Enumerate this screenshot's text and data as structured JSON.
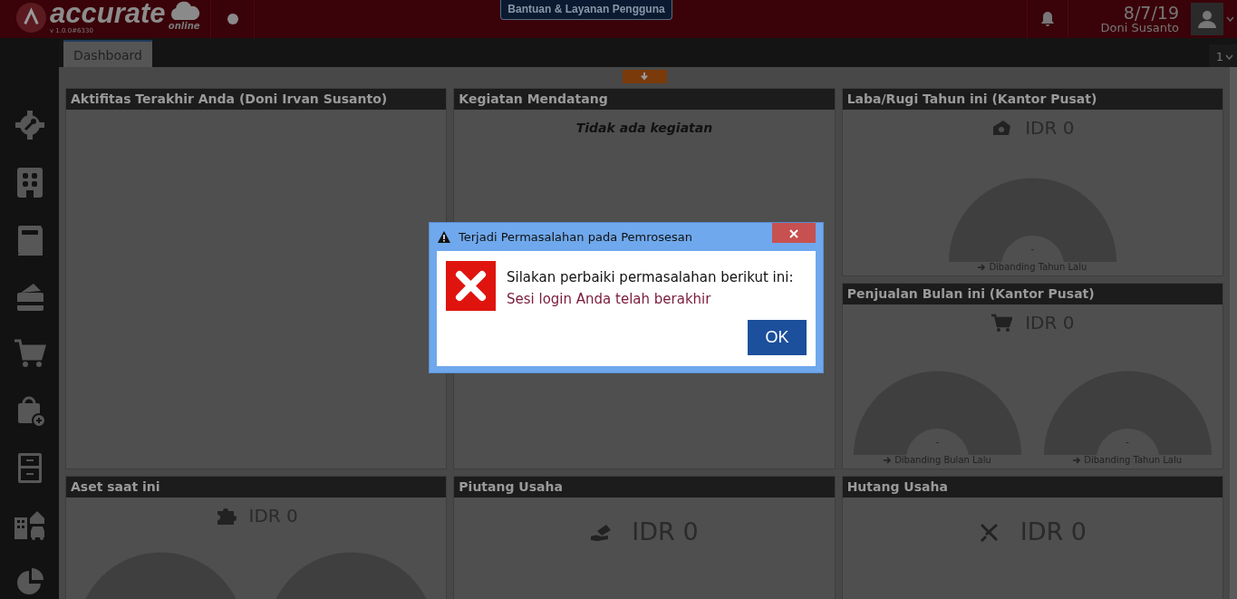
{
  "header": {
    "logo_text": "accurate",
    "logo_subtext": "online",
    "version": "v 1.0.0#6330",
    "help_button": "Bantuan & Layanan Pengguna",
    "date": "8/7/19",
    "user": "Doni Susanto"
  },
  "tabs": [
    {
      "label": "Dashboard",
      "selected": true
    }
  ],
  "page_selector": "1",
  "panels": [
    {
      "kind": "activity",
      "title": "Aktifitas Terakhir Anda (Doni Irvan Susanto)"
    },
    {
      "kind": "events",
      "title": "Kegiatan Mendatang",
      "message": "Tidak ada kegiatan"
    },
    {
      "kind": "gauge",
      "title": "Laba/Rugi Tahun ini (Kantor Pusat)",
      "amount": "IDR 0",
      "gauges": [
        {
          "kind": "labeled",
          "value": "-",
          "caption": "Dibanding Tahun Lalu"
        }
      ]
    },
    {
      "kind": "gauge",
      "title": "Penjualan Bulan ini (Kantor Pusat)",
      "amount": "IDR 0",
      "gauges": [
        {
          "kind": "labeled",
          "value": "-",
          "caption": "Dibanding Bulan Lalu"
        },
        {
          "kind": "labeled",
          "value": "-",
          "caption": "Dibanding Tahun Lalu"
        }
      ]
    },
    {
      "kind": "gauge",
      "title": "Aset saat ini",
      "amount": "IDR 0",
      "gauges": [
        {
          "kind": "bare"
        },
        {
          "kind": "bare"
        }
      ]
    },
    {
      "kind": "amount",
      "title": "Piutang Usaha",
      "amount": "IDR 0"
    },
    {
      "kind": "amount",
      "title": "Hutang Usaha",
      "amount": "IDR 0"
    }
  ],
  "dialog": {
    "title": "Terjadi Permasalahan pada Pemrosesan",
    "message": "Silakan perbaiki permasalahan berikut ini:",
    "error": "Sesi login Anda telah berakhir",
    "button": "OK"
  }
}
